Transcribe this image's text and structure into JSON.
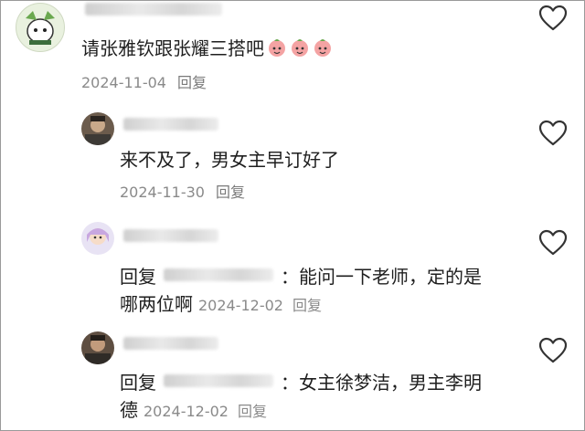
{
  "comments": [
    {
      "text": "请张雅钦跟张耀三搭吧",
      "date": "2024-11-04",
      "reply_label": "回复"
    },
    {
      "text": "来不及了，男女主早订好了",
      "date": "2024-11-30",
      "reply_label": "回复"
    },
    {
      "prefix": "回复",
      "text": "：能问一下老师，定的是",
      "text_line2": "哪两位啊",
      "date": "2024-12-02",
      "reply_label": "回复"
    },
    {
      "prefix": "回复",
      "text": "：女主徐梦洁，男主李明",
      "text_line2": "德",
      "date": "2024-12-02",
      "reply_label": "回复"
    }
  ],
  "icons": {
    "like": "heart-outline-icon",
    "sticker": "peach-face-sticker"
  },
  "colors": {
    "text": "#1e1e1e",
    "meta": "#8a8a8a",
    "heart_stroke": "#333333",
    "sticker": "#f08080"
  }
}
